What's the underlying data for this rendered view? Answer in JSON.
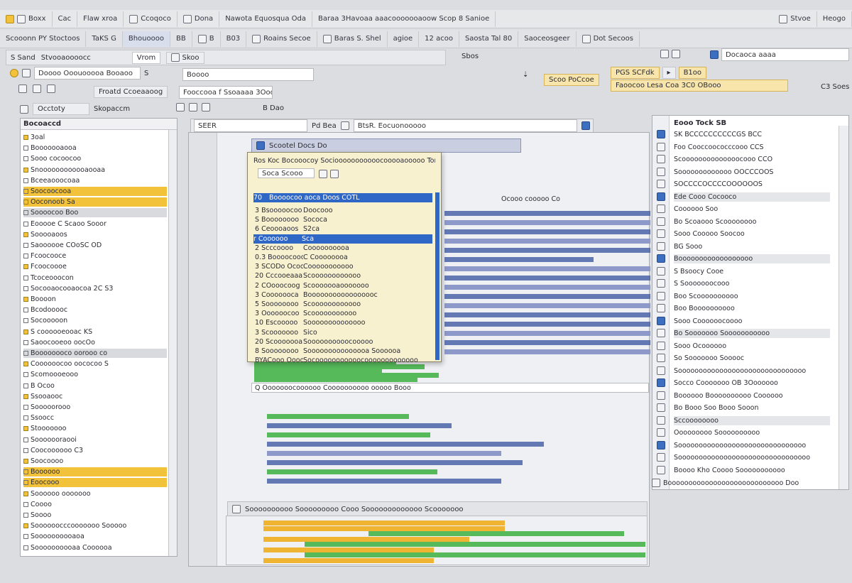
{
  "toolbar1": {
    "items": [
      "Boxx",
      "Cac",
      "Flaw xroa",
      "Ccoqoco",
      "Dona",
      "Nawota Equosqua Oda",
      "Baraa 3Havoaa aaacooooooaoow Scop 8 Sanioe",
      "Stvoe",
      "Heogo"
    ]
  },
  "toolbar2": {
    "items": [
      "Scooonn PY Stoctoos",
      "TaKS G",
      "Bhouoooo",
      "BB",
      "B",
      "B03",
      "Roains Secoe",
      "Baras S. Shel",
      "agioe",
      "12 acoo",
      "Saosta Tal 80",
      "Saoceosgeer",
      "Dot Secoos"
    ]
  },
  "row3": {
    "left_label": "S Sand",
    "left_mid": "Stvooaoooocc",
    "tab1": "Vrom",
    "tab2": "Skoo",
    "center_text": "Sbos",
    "right_chips": [
      "Docaoca",
      "aaaa",
      "PGS SCFdk",
      "B1oo"
    ]
  },
  "row4": {
    "left_field": "Doooo Ooouooooa Booaoo",
    "left_field2": "S",
    "mid_field": "Boooo",
    "mid_chip": "Scoo PoCcoe",
    "right_chip": "Faoocoo Lesa  Coa 3C0 OBooo"
  },
  "row5": {
    "a": "Froatd Ccoeaaoog",
    "b": "Fooccooa  f  Ssoaaaa 3Ooo",
    "right": "C3 Soes"
  },
  "row6": {
    "tab_a": "Occtoty",
    "tab_b": "Skopaccm",
    "tab_c": "B Dao",
    "search_a": "SEER",
    "search_b": "Pd  Bea",
    "search_c": "BtsR.  Eocuonooooo"
  },
  "left_panel": {
    "title": "Bocoaccd",
    "rows": [
      {
        "label": "3oal"
      },
      {
        "label": "Booooooaooa"
      },
      {
        "label": "Sooo cocoocoo"
      },
      {
        "label": "Snoooooooooooaooaa"
      },
      {
        "label": "Bceeaooocoaa"
      },
      {
        "label": "Soocoocooa",
        "hl": true
      },
      {
        "label": "Ooconoob  Sa",
        "hl": true
      },
      {
        "label": "Soooocoo  Boo",
        "hl2": true
      },
      {
        "label": "Eooooe  C Scaoo Sooor"
      },
      {
        "label": "Sooooaoos"
      },
      {
        "label": "Saoooooe  COoSC OD"
      },
      {
        "label": "Fcoocooce"
      },
      {
        "label": "Fcoocoooe"
      },
      {
        "label": "Tcoceooocon"
      },
      {
        "label": "Socooaocooaocoa 2C S3"
      },
      {
        "label": "Boooon"
      },
      {
        "label": "Bcodooooc"
      },
      {
        "label": "Socooooon"
      },
      {
        "label": "S coooooeooac KS"
      },
      {
        "label": "Saoocooeoo oocOo"
      },
      {
        "label": "Boooooooco oorooo  co",
        "hl2": true
      },
      {
        "label": "Coooooocoo oococoo  S"
      },
      {
        "label": "Scomoooeooo"
      },
      {
        "label": "B Ocoo"
      },
      {
        "label": "Ssooaooc"
      },
      {
        "label": "Sooooorooo"
      },
      {
        "label": "Ssoocc"
      },
      {
        "label": "Stooooooo"
      },
      {
        "label": "Sooooooraooi"
      },
      {
        "label": "Coocoooooo  C3"
      },
      {
        "label": "Soocoooo"
      },
      {
        "label": "Boooooo",
        "hl": true
      },
      {
        "label": "Eoocooo",
        "hl": true
      },
      {
        "label": "Soooooo ooooooo"
      },
      {
        "label": "Coooo"
      },
      {
        "label": "Soooo"
      },
      {
        "label": "Soooooocccooooooo  Sooooo"
      },
      {
        "label": "Soooooooooaoa"
      },
      {
        "label": "Soooooooooaa  Coooooa"
      }
    ]
  },
  "center": {
    "tab_label": "Scootel  Docs  Do",
    "popup": {
      "header": "Ros Koc  Bocooocoy  Sociooooooooooocooooaooooo  Tor",
      "filter_label": "Soca  Scooo",
      "sel_header_a": "70",
      "sel_header_b": "Boooocoo  aoca  Doos  COTL",
      "rows": [
        {
          "a": "3  Bsooooocoo",
          "b": "Doocooo"
        },
        {
          "a": "S  Boooooooo",
          "b": "Sococa"
        },
        {
          "a": "6  Ceoooaoos",
          "b": "S2ca"
        },
        {
          "a": "r  Coooooo",
          "b": "Sca",
          "sel": true
        },
        {
          "a": "2  Scccoooo",
          "b": "Coooooooooa"
        },
        {
          "a": "0.3  Boooocooo",
          "b": "C Coooooooa"
        },
        {
          "a": "3 SCODo  Ocoo",
          "b": "Cooooooooooo"
        },
        {
          "a": "20  Cccooeaaa",
          "b": "Scoooooooooooo"
        },
        {
          "a": "2  COooocoog",
          "b": "Scooooooaooooooo"
        },
        {
          "a": "3 Cooooooca",
          "b": "Booooooooooooooooc"
        },
        {
          "a": "5  Soooooooo",
          "b": "Scoooooooooooo"
        },
        {
          "a": "3 Oooooocoo",
          "b": "Scooooooooooo"
        },
        {
          "a": "10  Escooooo",
          "b": "Soooooooooooooo"
        },
        {
          "a": "3  Scooooooo",
          "b": "Sico"
        },
        {
          "a": "20  Scooooooa",
          "b": "Soooooooooocooooo"
        },
        {
          "a": "8  Soooooooo",
          "b": "Sooooooooooooooa  Soooooa"
        },
        {
          "a": "BYACooo  Ooooco",
          "b": "Socooooooooooocooooooooooooo"
        }
      ]
    },
    "right_header_text": "Ocooo  cooooo  Co",
    "status_text": "Q Ooooooocoooooo  Coooooooooo  ooooo  Booo"
  },
  "right_panel": {
    "title": "Eooo Tock SB",
    "rows": [
      {
        "label": "SK  BCCCCCCCCCCGS  BCC"
      },
      {
        "label": "Foo  Cooccoococccooo  CCS"
      },
      {
        "label": "Scoooooooooooooocooo  CCO"
      },
      {
        "label": "Sooooooooooooo  OOCCCOOS"
      },
      {
        "label": "SOCCCCOCCCCOOOOOOS"
      },
      {
        "label": "Ede  Cooo Cocooco",
        "hl": true
      },
      {
        "label": "Coooooo  Soo"
      },
      {
        "label": "Bo  Scoaooo Scoooooooo"
      },
      {
        "label": "Sooo  Cooooo  Soocoo"
      },
      {
        "label": "BG  Sooo"
      },
      {
        "label": "Boooooooooooooooooo",
        "hl": true
      },
      {
        "label": "S  Bsoocy Cooe"
      },
      {
        "label": "S  Sooooooocooo"
      },
      {
        "label": "Boo  Scoooooooooo"
      },
      {
        "label": "Boo  Boooooooooo"
      },
      {
        "label": "Sooo  Coooooocoooo"
      },
      {
        "label": "Bo  Sooooooo Sooooooooooo",
        "hl": true
      },
      {
        "label": "Sooo  Ocoooooo"
      },
      {
        "label": "So  Sooooooo  Sooooc"
      },
      {
        "label": "Sooooooooooooooooooooooooooooooo"
      },
      {
        "label": "Socco  Cooooooo  OB  3Ooooooo"
      },
      {
        "label": "Boooooo  Boooooooooo  Coooooo"
      },
      {
        "label": "Bo  Booo  Soo  Booo  Sooon"
      },
      {
        "label": "Sccoooooooo",
        "hl": true
      },
      {
        "label": "Ooooooooo  Soooooooooo"
      },
      {
        "label": "Sooooooooooooooooooooooooooooooo"
      },
      {
        "label": "Soooooooooooooooooooooooooooooooo"
      },
      {
        "label": "Boooo  Kho  Coooo  Sooooooooooo"
      }
    ],
    "footer": "Boooooooooooooooooooooooooooo  Doo"
  },
  "bottom_strip": {
    "text": "Soooooooooo  Sooooooooo  Cooo  Sooooooooooooo  Scooooooo"
  }
}
